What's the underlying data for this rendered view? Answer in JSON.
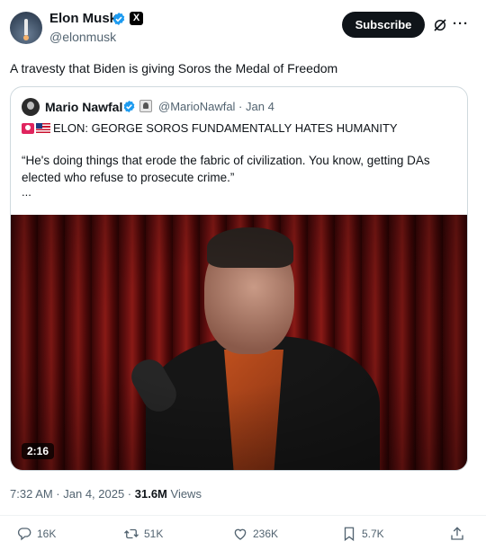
{
  "tweet": {
    "author_name": "Elon Musk",
    "author_handle": "@elonmusk",
    "affiliate_label": "X",
    "subscribe_label": "Subscribe",
    "more_label": "···",
    "text": "A travesty that Biden is giving Soros the Medal of Freedom",
    "time": "7:32 AM · Jan 4, 2025 · ",
    "views_count": "31.6M",
    "views_label": " Views"
  },
  "quote": {
    "author_name": "Mario Nawfal",
    "meta": "@MarioNawfal · Jan 4",
    "headline": "ELON: GEORGE SOROS FUNDAMENTALLY HATES HUMANITY",
    "body": "“He's doing things that erode the fabric of civilization. You know, getting DAs elected who refuse to prosecute crime.”",
    "ellipsis": "...",
    "video_duration": "2:16"
  },
  "actions": {
    "replies": "16K",
    "reposts": "51K",
    "likes": "236K",
    "bookmarks": "5.7K"
  },
  "colors": {
    "verified_blue": "#1d9bf0",
    "text_primary": "#0f1419",
    "text_secondary": "#536471",
    "border": "#cfd9de"
  }
}
